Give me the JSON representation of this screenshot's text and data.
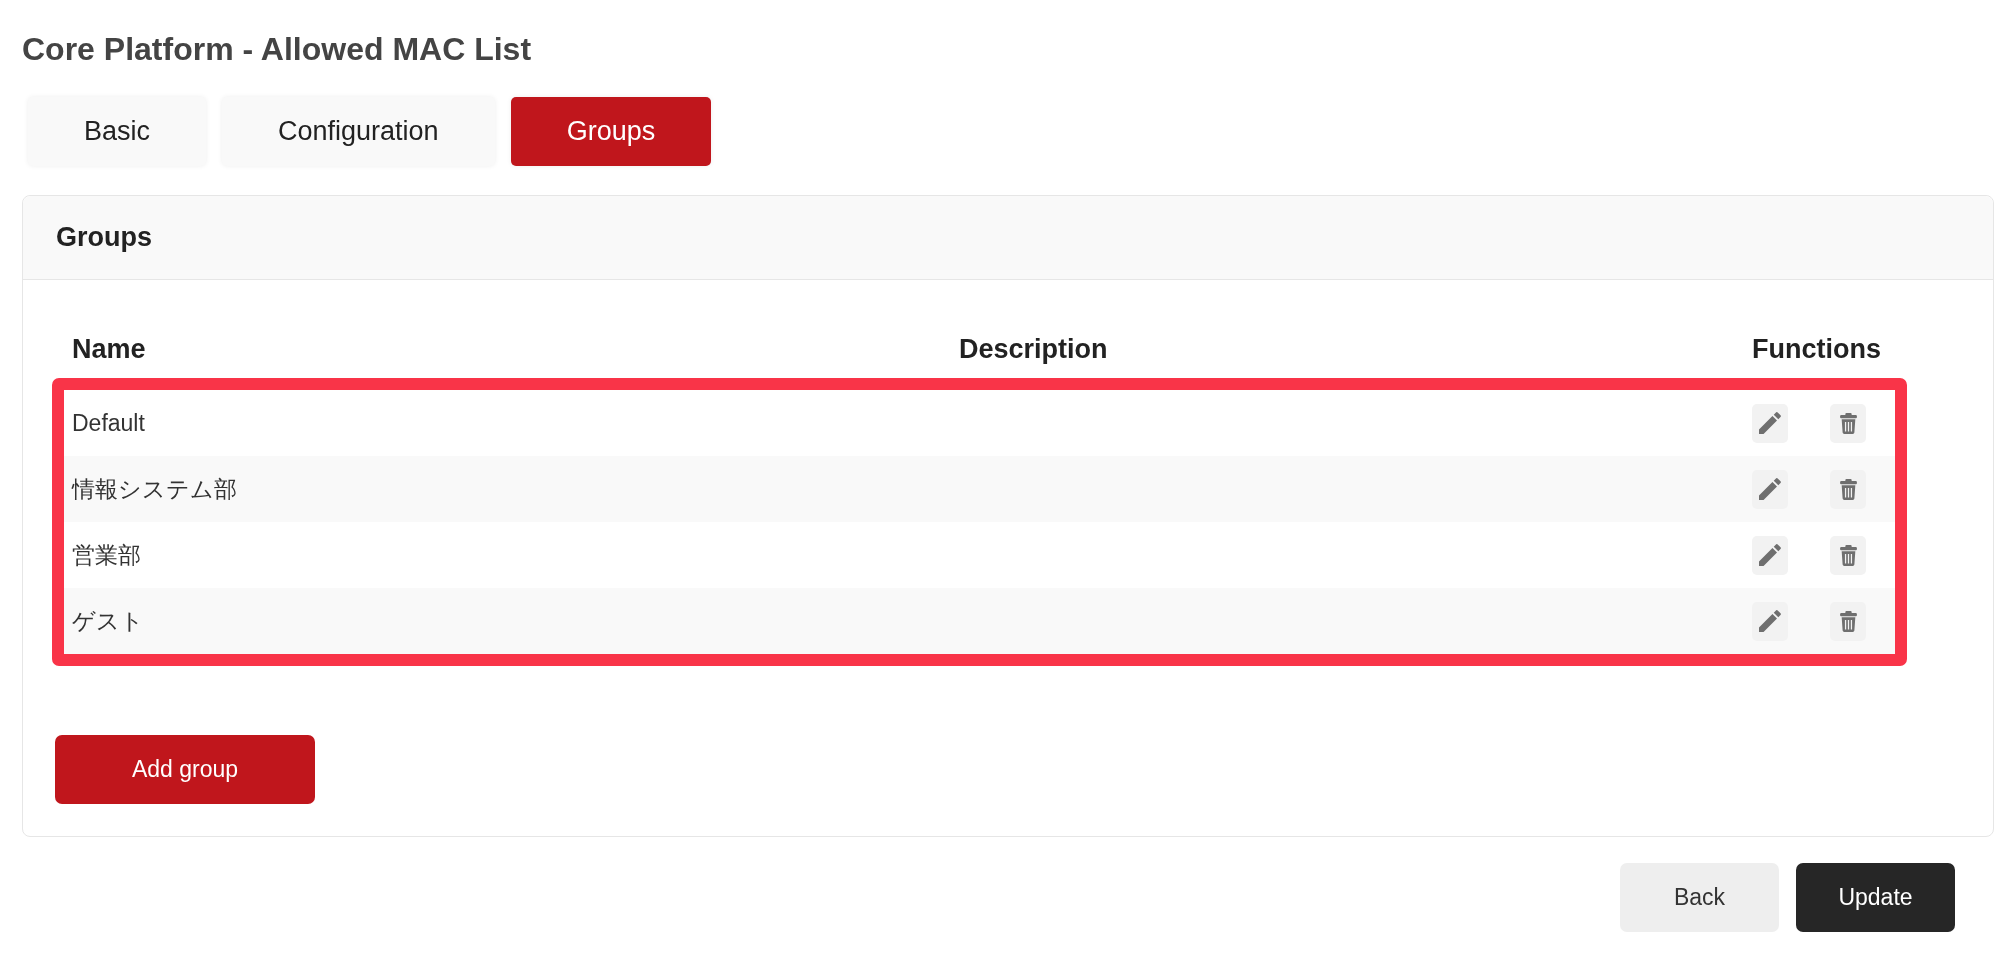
{
  "page_title": "Core Platform - Allowed MAC List",
  "tabs": [
    {
      "label": "Basic",
      "selected": false
    },
    {
      "label": "Configuration",
      "selected": false
    },
    {
      "label": "Groups",
      "selected": true
    }
  ],
  "panel": {
    "title": "Groups",
    "table": {
      "columns": [
        "Name",
        "Description",
        "Functions"
      ],
      "highlighted": true,
      "rows": [
        {
          "name": "Default"
        },
        {
          "name": "情報システム部"
        },
        {
          "name": "営業部"
        },
        {
          "name": "ゲスト"
        }
      ]
    },
    "add_button": "Add group"
  },
  "footer_buttons": [
    {
      "label": "Back",
      "kind": "secondary"
    },
    {
      "label": "Update",
      "kind": "primary"
    }
  ]
}
